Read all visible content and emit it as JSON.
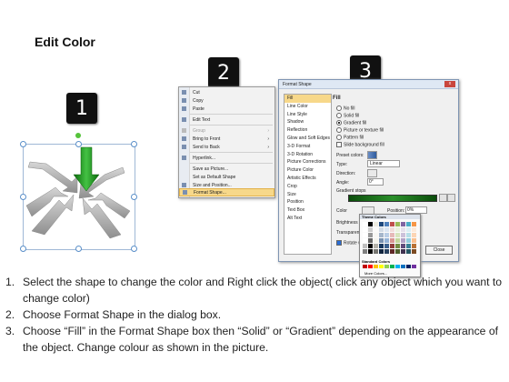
{
  "title": "Edit Color",
  "badges": [
    "1",
    "2",
    "3"
  ],
  "context_menu": {
    "items": [
      {
        "label": "Cut",
        "icon": "scissors-icon",
        "disabled": false,
        "submenu": false
      },
      {
        "label": "Copy",
        "icon": "copy-icon",
        "disabled": false,
        "submenu": false
      },
      {
        "label": "Paste",
        "icon": "paste-icon",
        "disabled": false,
        "submenu": false
      },
      {
        "label": "Edit Text",
        "icon": "text-icon",
        "disabled": false,
        "submenu": false
      },
      {
        "label": "Group",
        "icon": "group-icon",
        "disabled": true,
        "submenu": true
      },
      {
        "label": "Bring to Front",
        "icon": "bring-front-icon",
        "disabled": false,
        "submenu": true
      },
      {
        "label": "Send to Back",
        "icon": "send-back-icon",
        "disabled": false,
        "submenu": true
      },
      {
        "label": "Hyperlink...",
        "icon": "hyperlink-icon",
        "disabled": false,
        "submenu": false
      },
      {
        "label": "Save as Picture...",
        "icon": "",
        "disabled": false,
        "submenu": false
      },
      {
        "label": "Set as Default Shape",
        "icon": "",
        "disabled": false,
        "submenu": false
      },
      {
        "label": "Size and Position...",
        "icon": "size-icon",
        "disabled": false,
        "submenu": false
      },
      {
        "label": "Format Shape...",
        "icon": "format-shape-icon",
        "disabled": false,
        "submenu": false,
        "highlighted": true
      }
    ]
  },
  "dialog": {
    "title": "Format Shape",
    "close_glyph": "x",
    "categories": [
      "Fill",
      "Line Color",
      "Line Style",
      "Shadow",
      "Reflection",
      "Glow and Soft Edges",
      "3-D Format",
      "3-D Rotation",
      "Picture Corrections",
      "Picture Color",
      "Artistic Effects",
      "Crop",
      "Size",
      "Position",
      "Text Box",
      "Alt Text"
    ],
    "selected_category": "Fill",
    "fill": {
      "heading": "Fill",
      "options": [
        {
          "label": "No fill",
          "selected": false
        },
        {
          "label": "Solid fill",
          "selected": false
        },
        {
          "label": "Gradient fill",
          "selected": true
        },
        {
          "label": "Picture or texture fill",
          "selected": false
        },
        {
          "label": "Pattern fill",
          "selected": false
        }
      ],
      "slide_background": "Slide background fill",
      "preset_colors_label": "Preset colors:",
      "type_label": "Type:",
      "type_value": "Linear",
      "direction_label": "Direction:",
      "angle_label": "Angle:",
      "angle_value": "0°",
      "gradient_stops_label": "Gradient stops",
      "color_label": "Color",
      "position_label": "Position:",
      "position_value": "0%",
      "brightness_label": "Brightness",
      "transparency_label": "Transparency",
      "rotate_label": "Rotate with shape",
      "close_label": "Close"
    },
    "palette": {
      "theme_header": "Theme Colors",
      "standard_header": "Standard Colors",
      "more_label": "More Colors...",
      "theme_top": [
        "#ffffff",
        "#000000",
        "#eeece1",
        "#1f497d",
        "#4f81bd",
        "#c0504d",
        "#9bbb59",
        "#8064a2",
        "#4bacc6",
        "#f79646"
      ],
      "standard": [
        "#c00000",
        "#ff0000",
        "#ffc000",
        "#ffff00",
        "#92d050",
        "#00b050",
        "#00b0f0",
        "#0070c0",
        "#002060",
        "#7030a0"
      ]
    }
  },
  "steps": [
    {
      "num": "1.",
      "text": "Select the shape to change the color and Right click the object( click any object which you want to change color)"
    },
    {
      "num": "2.",
      "text": "Choose Format Shape in the dialog box."
    },
    {
      "num": "3.",
      "text": "Choose “Fill” in the Format Shape box then “Solid” or “Gradient” depending on the appearance of the object. Change colour as shown in the picture."
    }
  ]
}
